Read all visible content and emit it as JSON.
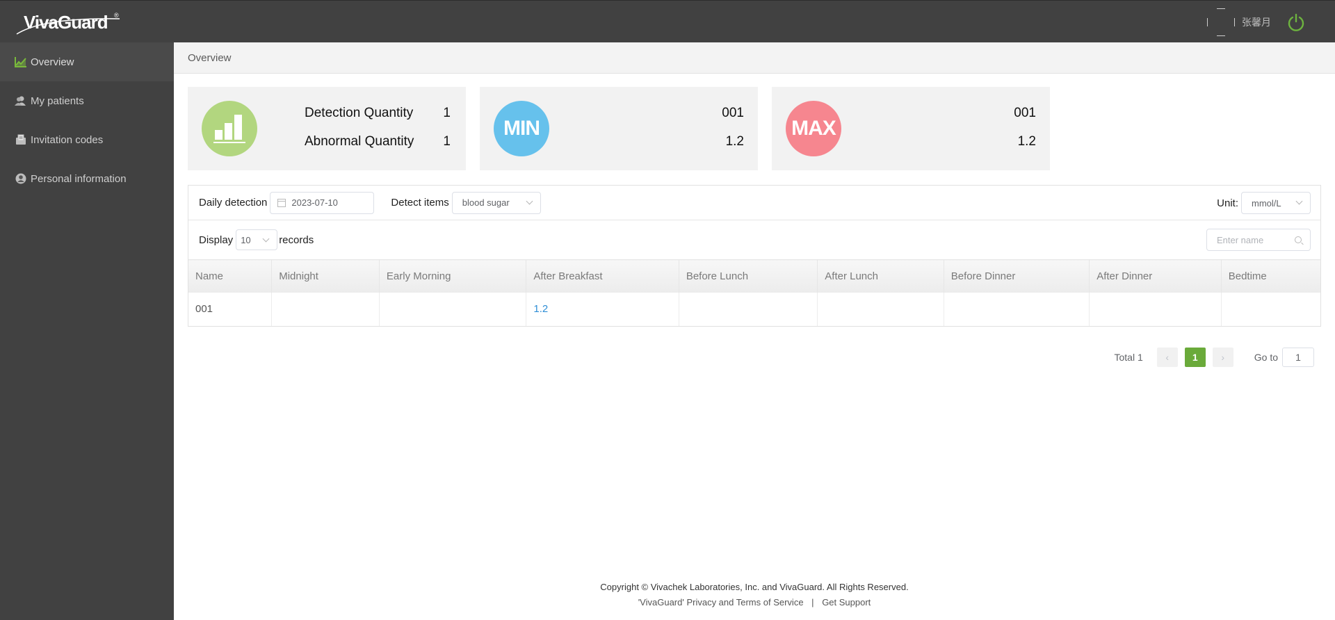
{
  "header": {
    "brand": "VivaGuard",
    "brand_mark": "®",
    "username": "张馨月"
  },
  "sidebar": {
    "items": [
      {
        "label": "Overview",
        "icon": "chart-line-icon",
        "active": true
      },
      {
        "label": "My patients",
        "icon": "users-icon",
        "active": false
      },
      {
        "label": "Invitation codes",
        "icon": "envelope-icon",
        "active": false
      },
      {
        "label": "Personal information",
        "icon": "user-circle-icon",
        "active": false
      }
    ]
  },
  "breadcrumb": {
    "current": "Overview"
  },
  "cards": {
    "summary": {
      "detection_label": "Detection Quantity",
      "detection_value": "1",
      "abnormal_label": "Abnormal Quantity",
      "abnormal_value": "1",
      "color": "#b2d67f"
    },
    "min": {
      "badge": "MIN",
      "name": "001",
      "value": "1.2",
      "color": "#66c1ec"
    },
    "max": {
      "badge": "MAX",
      "name": "001",
      "value": "1.2",
      "color": "#f6868f"
    }
  },
  "filters": {
    "daily_label": "Daily detection",
    "date_value": "2023-07-10",
    "items_label": "Detect items",
    "items_value": "blood sugar",
    "unit_label": "Unit:",
    "unit_value": "mmol/L",
    "display_label": "Display",
    "display_value": "10",
    "records_label": "records",
    "search_placeholder": "Enter name"
  },
  "table": {
    "columns": [
      "Name",
      "Midnight",
      "Early Morning",
      "After Breakfast",
      "Before Lunch",
      "After Lunch",
      "Before Dinner",
      "After Dinner",
      "Bedtime"
    ],
    "rows": [
      [
        "001",
        "",
        "",
        "1.2",
        "",
        "",
        "",
        "",
        ""
      ]
    ]
  },
  "pagination": {
    "total_label": "Total 1",
    "prev": "‹",
    "current": "1",
    "next": "›",
    "goto_label": "Go to",
    "goto_value": "1",
    "accent": "#6aaa3a"
  },
  "footer": {
    "copyright": "Copyright © Vivachek Laboratories, Inc. and VivaGuard. All Rights Reserved.",
    "privacy": "'VivaGuard' Privacy and Terms of Service",
    "separator": "|",
    "support": "Get Support"
  }
}
